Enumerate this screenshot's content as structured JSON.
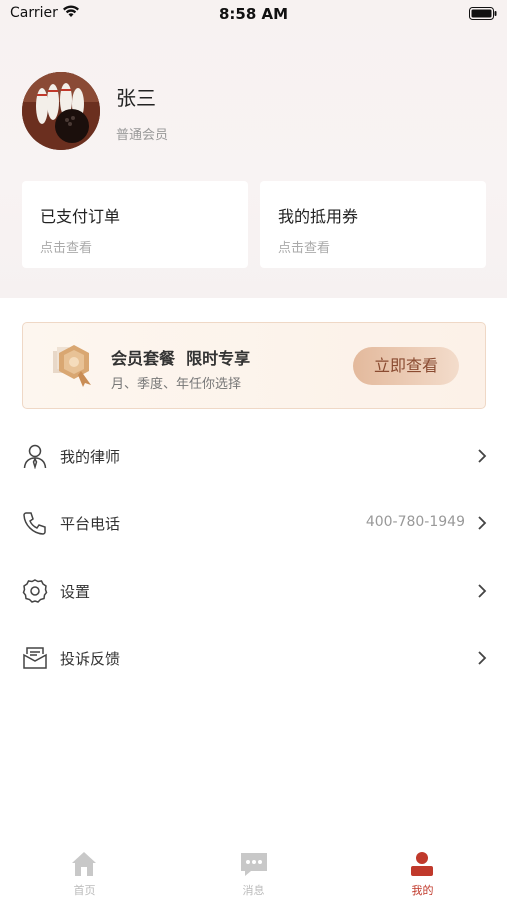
{
  "status_bar": {
    "carrier": "Carrier",
    "time": "8:58 AM"
  },
  "profile": {
    "name": "张三",
    "level": "普通会员"
  },
  "quick_cards": [
    {
      "title": "已支付订单",
      "subtitle": "点击查看"
    },
    {
      "title": "我的抵用券",
      "subtitle": "点击查看"
    }
  ],
  "banner": {
    "title": "会员套餐  限时专享",
    "subtitle": "月、季度、年任你选择",
    "button": "立即查看"
  },
  "menu": [
    {
      "label": "我的律师",
      "value": "",
      "icon": "lawyer-icon"
    },
    {
      "label": "平台电话",
      "value": "400-780-1949",
      "icon": "phone-icon"
    },
    {
      "label": "设置",
      "value": "",
      "icon": "gear-icon"
    },
    {
      "label": "投诉反馈",
      "value": "",
      "icon": "feedback-icon"
    }
  ],
  "tabs": [
    {
      "label": "首页",
      "icon": "home-icon",
      "active": false
    },
    {
      "label": "消息",
      "icon": "message-icon",
      "active": false
    },
    {
      "label": "我的",
      "icon": "user-icon",
      "active": true
    }
  ],
  "colors": {
    "accent": "#c0392b",
    "banner_button_text": "#8a4b31",
    "muted": "#999999"
  }
}
